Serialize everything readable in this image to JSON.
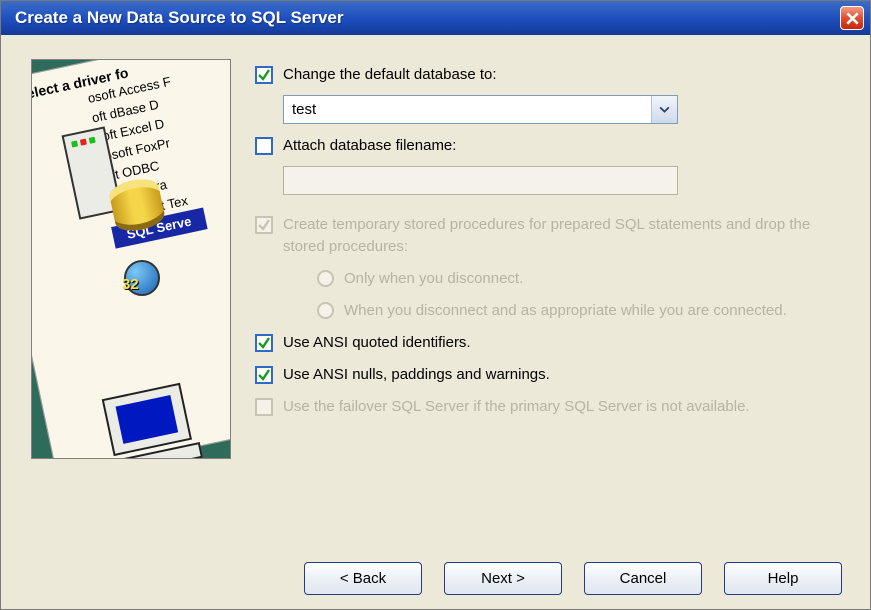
{
  "title": "Create a New Data Source to SQL Server",
  "wizard_image": {
    "paper_header": "Select a driver fo",
    "driver_list": [
      "osoft Access F",
      "oft dBase D",
      "soft Excel D",
      "rosoft FoxPr",
      "oft ODBC",
      "osoft Para",
      "Microsoft Tex"
    ],
    "sql_item": "SQL Serve",
    "badge_32": "32"
  },
  "change_db": {
    "label": "Change the default database to:",
    "checked": true,
    "value": "test"
  },
  "attach_file": {
    "label": "Attach database filename:",
    "checked": false,
    "value": ""
  },
  "temp_proc": {
    "label": "Create temporary stored procedures for prepared SQL statements and drop the stored procedures:",
    "checked": true,
    "enabled": false,
    "radio1": "Only when you disconnect.",
    "radio2": "When you disconnect and as appropriate while you are connected."
  },
  "ansi_quoted": {
    "label": "Use ANSI quoted identifiers.",
    "checked": true
  },
  "ansi_nulls": {
    "label": "Use ANSI nulls, paddings and warnings.",
    "checked": true
  },
  "failover": {
    "label": "Use the failover SQL Server if the primary SQL Server is not available.",
    "checked": false,
    "enabled": false
  },
  "buttons": {
    "back": "< Back",
    "next": "Next >",
    "cancel": "Cancel",
    "help": "Help"
  }
}
